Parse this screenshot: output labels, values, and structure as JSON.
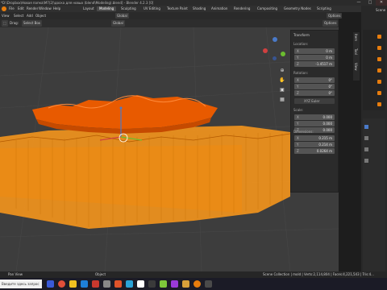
{
  "window": {
    "title": "*D:\\Dropbox\\Новая папка\\М7(2)\\доска для новых (blend\\Modeling).blend] - Blender 4.2.3 [0]",
    "minimize": "—",
    "maximize": "□",
    "close": "✕"
  },
  "menu": {
    "items": [
      "File",
      "Edit",
      "Render",
      "Window",
      "Help"
    ],
    "workspaces": [
      "Layout",
      "Modeling",
      "Sculpting",
      "UV Editing",
      "Texture Paint",
      "Shading",
      "Animation",
      "Rendering",
      "Compositing",
      "Geometry Nodes",
      "Scripting"
    ],
    "active_workspace": "Modeling",
    "scene_label": "Scene"
  },
  "header2": {
    "mode": "Object Mode",
    "view": "View",
    "select": "Select",
    "add": "Add",
    "object": "Object",
    "orientation": "Global",
    "drag": "Drag:",
    "drag_value": "Select Box",
    "options": "Options"
  },
  "transform_panel": {
    "title": "Transform",
    "location_label": "Location:",
    "location": [
      {
        "k": "X",
        "v": "0 m"
      },
      {
        "k": "Y",
        "v": "0 m"
      },
      {
        "k": "Z",
        "v": "-1.4517 m"
      }
    ],
    "rotation_label": "Rotation:",
    "rotation": [
      {
        "k": "X",
        "v": "0°"
      },
      {
        "k": "Y",
        "v": "0°"
      },
      {
        "k": "Z",
        "v": "0°"
      }
    ],
    "rotation_mode": "XYZ Euler",
    "scale_label": "Scale:",
    "scale": [
      {
        "k": "X",
        "v": "0.000"
      },
      {
        "k": "Y",
        "v": "0.000"
      },
      {
        "k": "Z",
        "v": "0.000"
      }
    ],
    "dimensions_label": "Dimensions:",
    "dimensions": [
      {
        "k": "X",
        "v": "0.215 m"
      },
      {
        "k": "Y",
        "v": "0.214 m"
      },
      {
        "k": "Z",
        "v": "0.0264 m"
      }
    ]
  },
  "sidebar_tabs": [
    "Item",
    "Tool",
    "View"
  ],
  "status": {
    "left1": "Pan View",
    "left2": "Object",
    "right": "Scene Collection | mold | Verts:2,114,804 | Faces:4,221,543 | Tris:4..."
  },
  "taskbar": {
    "search_placeholder": "Введите здесь запрос"
  },
  "colors": {
    "mesh_top": "#e85a00",
    "mesh_base": "#ff9a1a",
    "viewport_bg": "#3d3d3d",
    "accent_blue": "#4a7ac9"
  }
}
